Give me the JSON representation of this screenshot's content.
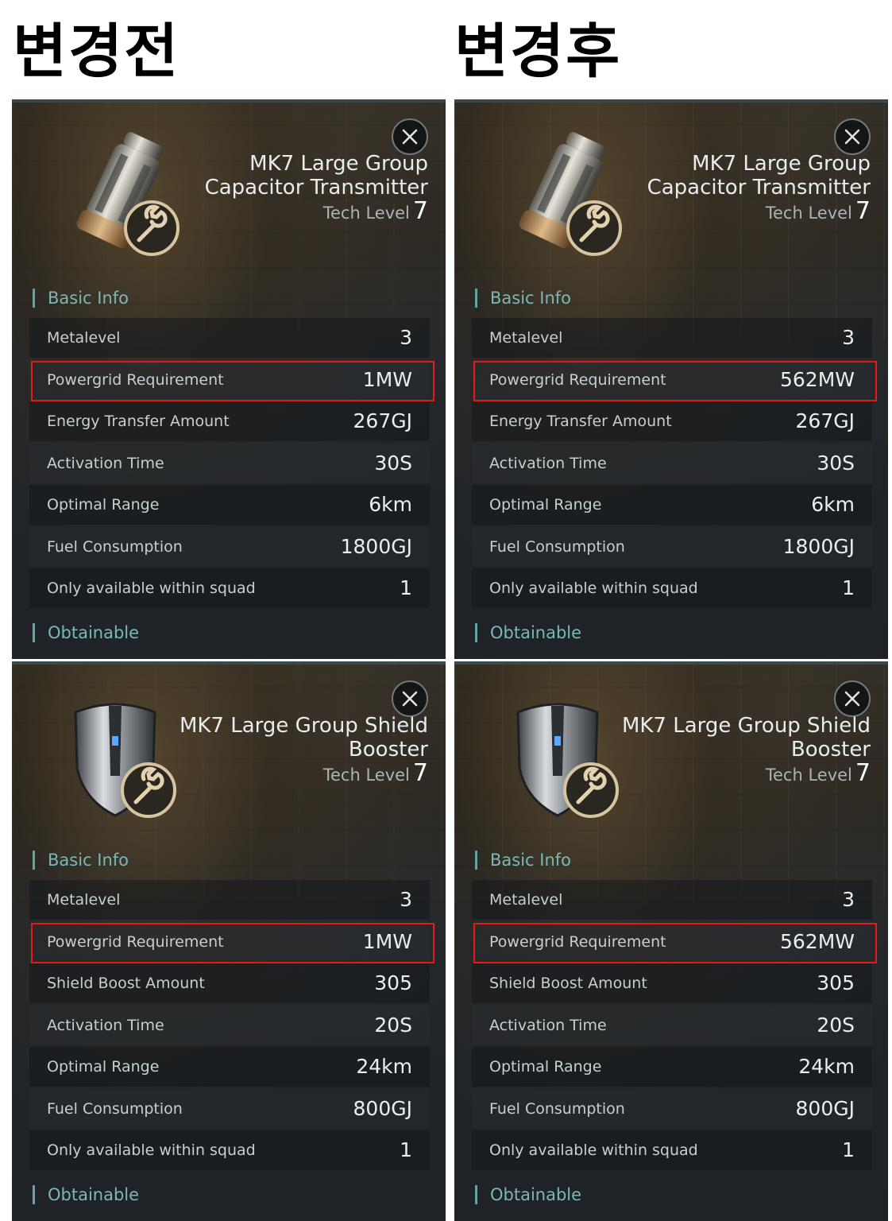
{
  "headings": {
    "before": "변경전",
    "after": "변경후"
  },
  "colors": {
    "highlight": "#e21a1a",
    "accent": "#7ab8b5"
  },
  "panels": [
    {
      "item_icon": "capacitor-canister-icon",
      "title_lines": [
        "MK7 Large Group",
        "Capacitor Transmitter"
      ],
      "tech_label": "Tech Level",
      "tech_level": "7",
      "basic_info": "Basic Info",
      "obtainable": "Obtainable",
      "rows": [
        {
          "label": "Metalevel",
          "value": "3"
        },
        {
          "label": "Powergrid Requirement",
          "value": "1MW"
        },
        {
          "label": "Energy Transfer Amount",
          "value": "267GJ"
        },
        {
          "label": "Activation Time",
          "value": "30S"
        },
        {
          "label": "Optimal Range",
          "value": "6km"
        },
        {
          "label": "Fuel Consumption",
          "value": "1800GJ"
        },
        {
          "label": "Only available within squad",
          "value": "1"
        }
      ]
    },
    {
      "item_icon": "capacitor-canister-icon",
      "title_lines": [
        "MK7 Large Group",
        "Capacitor Transmitter"
      ],
      "tech_label": "Tech Level",
      "tech_level": "7",
      "basic_info": "Basic Info",
      "obtainable": "Obtainable",
      "rows": [
        {
          "label": "Metalevel",
          "value": "3"
        },
        {
          "label": "Powergrid Requirement",
          "value": "562MW"
        },
        {
          "label": "Energy Transfer Amount",
          "value": "267GJ"
        },
        {
          "label": "Activation Time",
          "value": "30S"
        },
        {
          "label": "Optimal Range",
          "value": "6km"
        },
        {
          "label": "Fuel Consumption",
          "value": "1800GJ"
        },
        {
          "label": "Only available within squad",
          "value": "1"
        }
      ]
    },
    {
      "item_icon": "shield-booster-icon",
      "title_lines": [
        "MK7 Large Group Shield",
        "Booster"
      ],
      "tech_label": "Tech Level",
      "tech_level": "7",
      "basic_info": "Basic Info",
      "obtainable": "Obtainable",
      "rows": [
        {
          "label": "Metalevel",
          "value": "3"
        },
        {
          "label": "Powergrid Requirement",
          "value": "1MW"
        },
        {
          "label": "Shield Boost Amount",
          "value": "305"
        },
        {
          "label": "Activation Time",
          "value": "20S"
        },
        {
          "label": "Optimal Range",
          "value": "24km"
        },
        {
          "label": "Fuel Consumption",
          "value": "800GJ"
        },
        {
          "label": "Only available within squad",
          "value": "1"
        }
      ]
    },
    {
      "item_icon": "shield-booster-icon",
      "title_lines": [
        "MK7 Large Group Shield",
        "Booster"
      ],
      "tech_label": "Tech Level",
      "tech_level": "7",
      "basic_info": "Basic Info",
      "obtainable": "Obtainable",
      "rows": [
        {
          "label": "Metalevel",
          "value": "3"
        },
        {
          "label": "Powergrid Requirement",
          "value": "562MW"
        },
        {
          "label": "Shield Boost Amount",
          "value": "305"
        },
        {
          "label": "Activation Time",
          "value": "20S"
        },
        {
          "label": "Optimal Range",
          "value": "24km"
        },
        {
          "label": "Fuel Consumption",
          "value": "800GJ"
        },
        {
          "label": "Only available within squad",
          "value": "1"
        }
      ]
    }
  ]
}
